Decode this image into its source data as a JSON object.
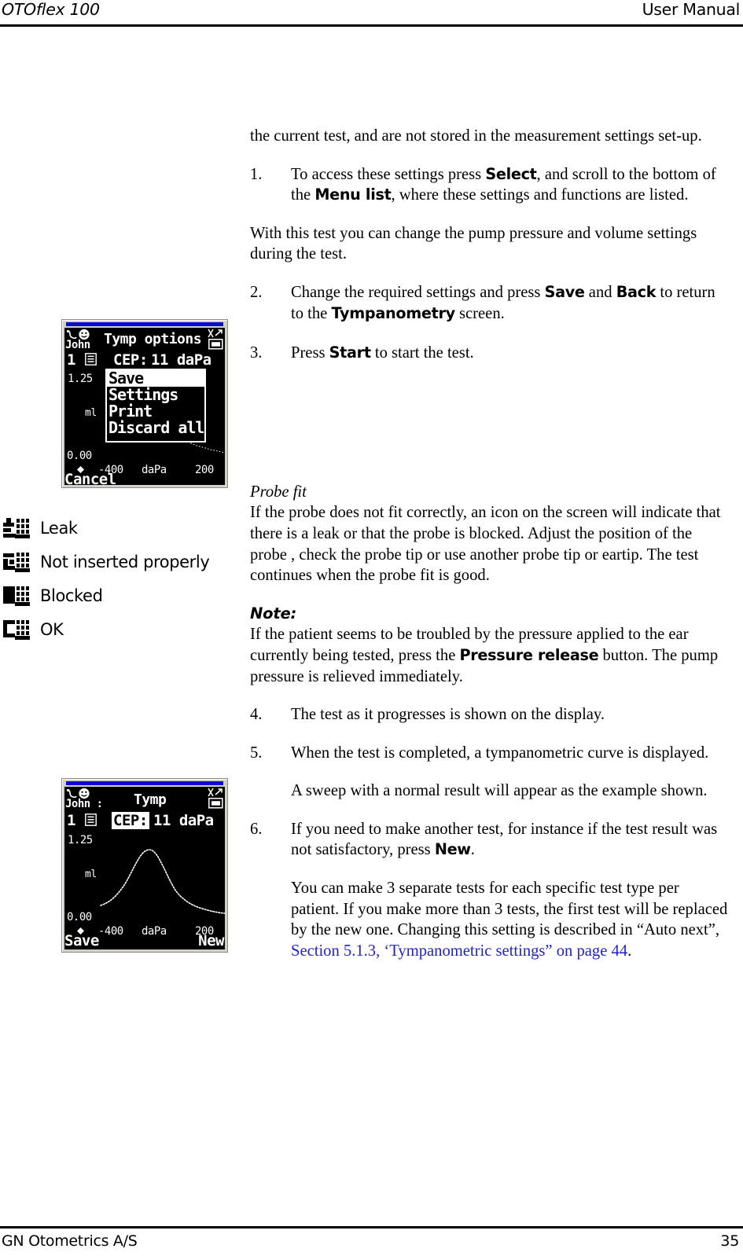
{
  "header": {
    "left": "OTOflex 100",
    "right": "User Manual"
  },
  "footer": {
    "left": "GN Otometrics A/S",
    "page_number": "35"
  },
  "body": {
    "intro_para": "the current test, and are not stored in the measurement settings set-up.",
    "step1": {
      "number": "1.",
      "text_a": "To access these settings press ",
      "bold_a": "Select",
      "text_b": ", and scroll to the bottom of the ",
      "bold_b": "Menu list",
      "text_c": ", where these settings and functions are listed."
    },
    "para_pump": "With this test you can change the pump pressure and volume settings during the test.",
    "step2": {
      "number": "2.",
      "text_a": "Change the required settings and press ",
      "bold_a": "Save",
      "text_b": " and ",
      "bold_b": "Back",
      "text_c": " to return to the ",
      "bold_c": "Tympanometry",
      "text_d": " screen."
    },
    "step3": {
      "number": "3.",
      "text_a": "Press ",
      "bold_a": "Start",
      "text_b": " to start the test."
    },
    "probe_fit": {
      "heading": "Probe fit",
      "text": "If the probe does not fit correctly, an icon on the screen will indicate that there is a leak or that the probe is blocked. Adjust the position of the probe , check the probe tip or use another probe tip or eartip. The test continues when the probe fit is good."
    },
    "note": {
      "heading": "Note:",
      "text_a": "If the patient seems to be troubled by the pressure applied to the ear currently being tested, press the ",
      "bold_a": "Pressure release",
      "text_b": " button. The pump pressure is relieved immediately."
    },
    "step4": {
      "number": "4.",
      "text_a": "The test as it progresses is shown on the display."
    },
    "step5": {
      "number": "5.",
      "text_a": "When the test is completed, a tympanometric curve is displayed.",
      "sub_text": "A sweep with a normal result will appear as the example shown."
    },
    "step6": {
      "number": "6.",
      "text_a": "If you need to make another test, for instance if the test result was not satisfactory, press ",
      "bold_a": "New",
      "text_b": ".",
      "sub_text_a": "You can make 3 separate tests for each specific test type per patient. If you make more than 3 tests, the first test will be replaced by the new one. Changing this setting is described in “Auto next”, ",
      "xref": "Section 5.1.3, ‘Tympanometric settings” on page 44",
      "sub_text_b": "."
    }
  },
  "legend": {
    "items": [
      {
        "icon": "probe-leak-icon",
        "label": "Leak"
      },
      {
        "icon": "probe-not-inserted-icon",
        "label": "Not inserted properly"
      },
      {
        "icon": "probe-blocked-icon",
        "label": "Blocked"
      },
      {
        "icon": "probe-ok-icon",
        "label": "OK"
      }
    ]
  },
  "device_screen_1": {
    "name": "tymp-options-menu-screen",
    "patient": "John",
    "title": "Tymp options",
    "test_number": "1",
    "reading_label": "CEP:",
    "reading_value": "11 daPa",
    "y_max": "1.25",
    "y_unit": "ml",
    "y_min": "0.00",
    "x_min": "-400",
    "x_unit": "daPa",
    "x_max": "200",
    "softkey_left": "Cancel",
    "menu_items": [
      {
        "label": "Save",
        "selected": true
      },
      {
        "label": "Settings",
        "selected": false
      },
      {
        "label": "Print",
        "selected": false
      },
      {
        "label": "Discard all",
        "selected": false
      }
    ]
  },
  "device_screen_2": {
    "name": "tymp-result-screen",
    "patient": "John :",
    "title": "Tymp",
    "test_number": "1",
    "reading_label": "CEP:",
    "reading_value": "11 daPa",
    "y_max": "1.25",
    "y_unit": "ml",
    "y_min": "0.00",
    "x_min": "-400",
    "x_unit": "daPa",
    "x_max": "200",
    "softkey_left": "Save",
    "softkey_right": "New"
  },
  "colors": {
    "xref_blue": "#2222cc",
    "titlebar_blue": "#0a0ad0",
    "lcd_black": "#000000",
    "lcd_white": "#ffffff",
    "frame_grey": "#d4d0c8"
  }
}
